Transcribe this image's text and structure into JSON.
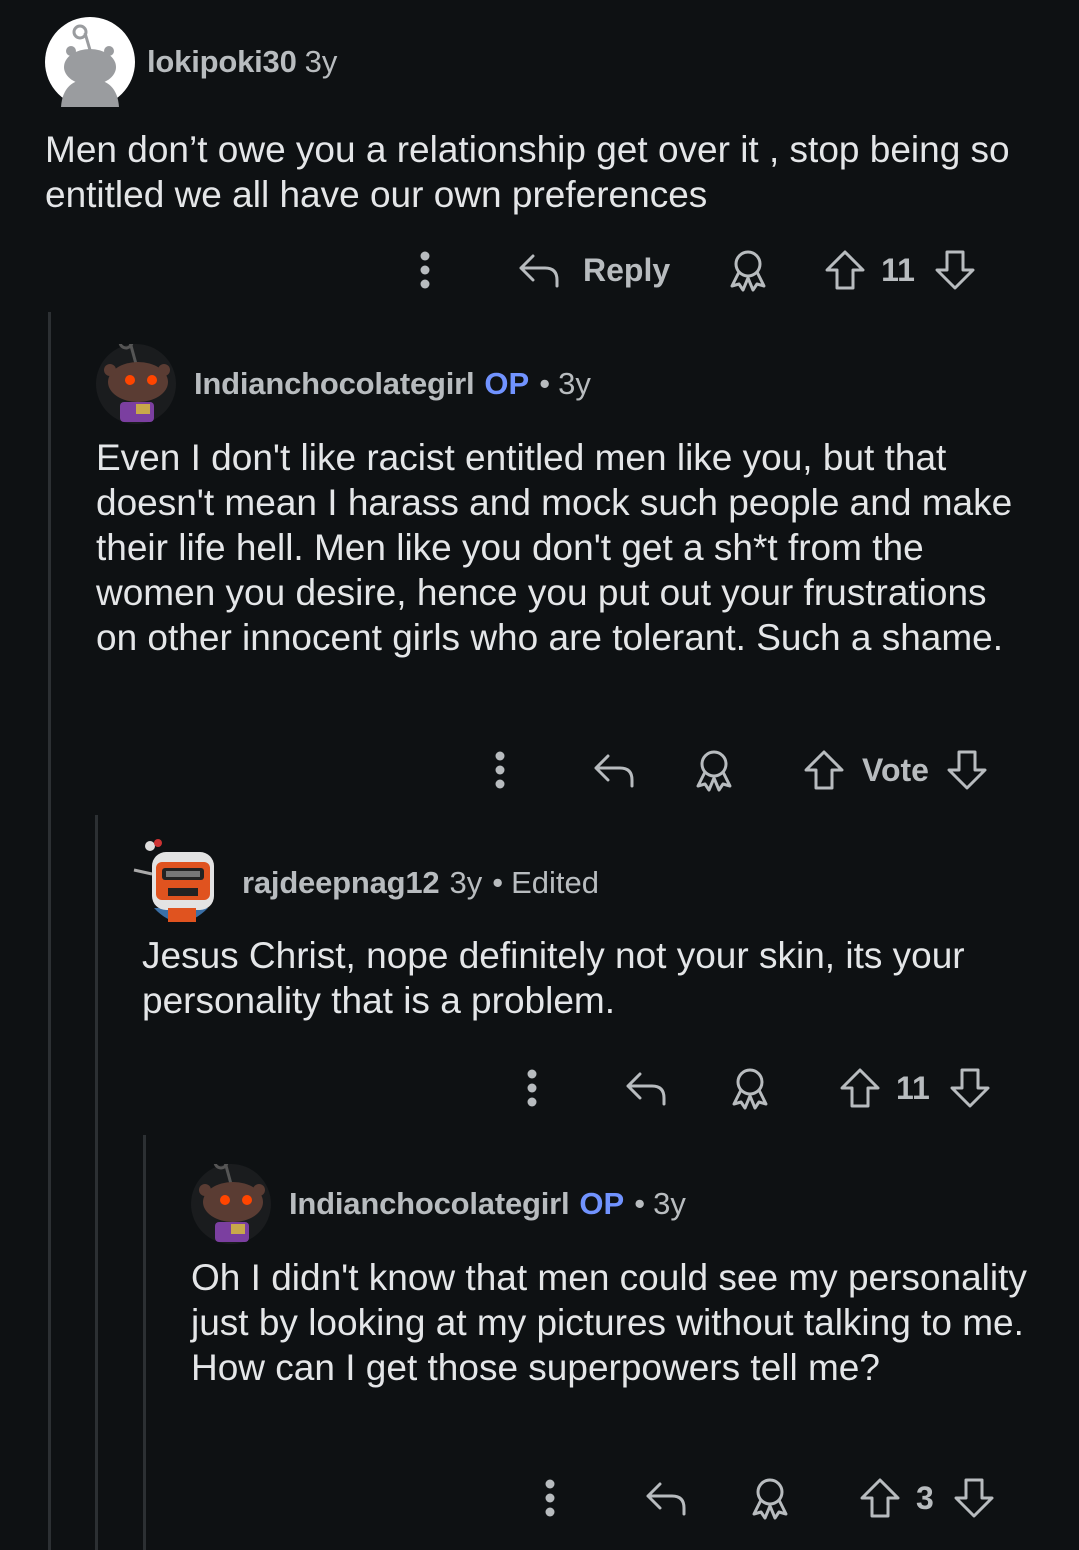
{
  "comments": [
    {
      "username": "lokipoki30",
      "op_badge": "",
      "time": "3y",
      "edited": "",
      "body": "Men don’t owe you a relationship get over it , stop being so entitled we all have our own preferences",
      "reply_label": "Reply",
      "score": "11"
    },
    {
      "username": "Indianchocolategirl",
      "op_badge": "OP",
      "time": "3y",
      "edited": "",
      "body": "Even I don't like racist entitled men like you, but that doesn't mean I harass and mock such people and make their life hell. Men like you don't get a sh*t from the women you desire, hence you put out your frustrations on other innocent girls who are tolerant. Such a shame.",
      "reply_label": "",
      "score": "Vote"
    },
    {
      "username": "rajdeepnag12",
      "op_badge": "",
      "time": "3y",
      "edited": "Edited",
      "body": "Jesus Christ, nope definitely not your skin, its your personality that is a problem.",
      "reply_label": "",
      "score": "11"
    },
    {
      "username": "Indianchocolategirl",
      "op_badge": "OP",
      "time": "3y",
      "edited": "",
      "body": "Oh I didn't know that men could see my personality just by looking at my pictures without talking to me. How can I get those superpowers tell me?",
      "reply_label": "",
      "score": "3"
    }
  ],
  "separator": "•",
  "icons": {
    "more": "more-vertical-icon",
    "reply": "reply-arrow-icon",
    "award": "award-icon",
    "upvote": "upvote-arrow-icon",
    "downvote": "downvote-arrow-icon"
  }
}
